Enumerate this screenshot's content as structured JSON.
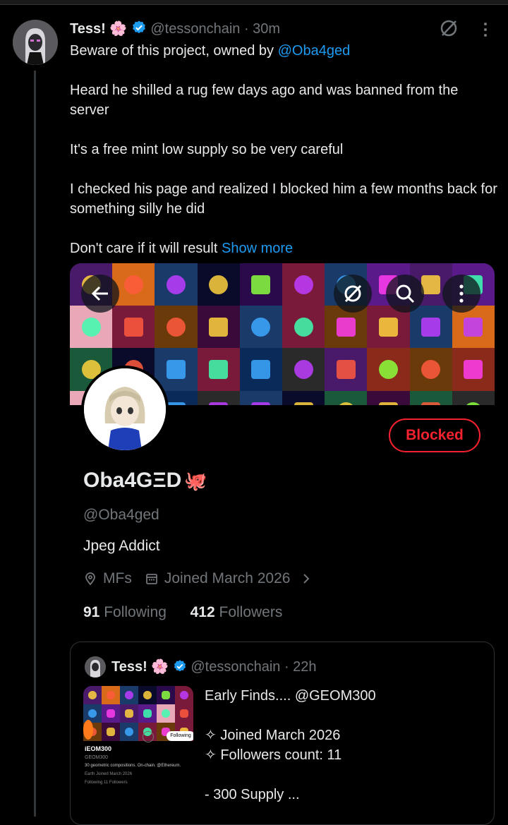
{
  "tweet": {
    "author_name": "Tess!",
    "author_emoji": "🌸",
    "handle": "@tessonchain",
    "time": "· 30m",
    "lines": [
      {
        "pre": "Beware of this project, owned by ",
        "link": "@Oba4ged"
      },
      {
        "pre": "",
        "link": ""
      },
      {
        "pre": "Heard he shilled a rug few days ago and was banned from the server",
        "link": ""
      },
      {
        "pre": "",
        "link": ""
      },
      {
        "pre": "It's a free mint low supply so be very careful",
        "link": ""
      },
      {
        "pre": "",
        "link": ""
      },
      {
        "pre": "I checked his page and realized I blocked him a few months back for something silly he did",
        "link": ""
      },
      {
        "pre": "",
        "link": ""
      },
      {
        "pre": "Don't care if it will result ",
        "link": "Show more"
      }
    ]
  },
  "profile": {
    "name": "Oba4GΞD",
    "name_emoji": "🐙",
    "handle": "@Oba4ged",
    "bio": "Jpeg Addict",
    "location": "MFs",
    "joined": "Joined March 2026",
    "following_count": "91",
    "following_label": "Following",
    "followers_count": "412",
    "followers_label": "Followers",
    "blocked_label": "Blocked"
  },
  "quote": {
    "author_name": "Tess!",
    "author_emoji": "🌸",
    "handle": "@tessonchain",
    "time": "· 22h",
    "lines": [
      "Early Finds.... @GEOM300",
      "",
      "✧ Joined March 2026",
      "✧ Followers count: 11",
      "",
      "- 300 Supply ..."
    ],
    "thumb": {
      "name": "iEOM300",
      "handle": "GEOM300",
      "bio": "30 geometric compositions. On-chain. @Ethereum.",
      "meta": "Earth   Joined March 2026",
      "stats": "Following   11 Followers",
      "follow_label": "Following"
    }
  },
  "colors": {
    "accent": "#1d9bf0",
    "blocked": "#f4212e",
    "muted": "#71767b",
    "text": "#e7e9ea",
    "background": "#000000"
  },
  "icons": [
    "grok-icon",
    "more-icon",
    "back-arrow-icon",
    "search-icon",
    "location-icon",
    "calendar-icon",
    "chevron-right-icon",
    "verified-icon"
  ]
}
